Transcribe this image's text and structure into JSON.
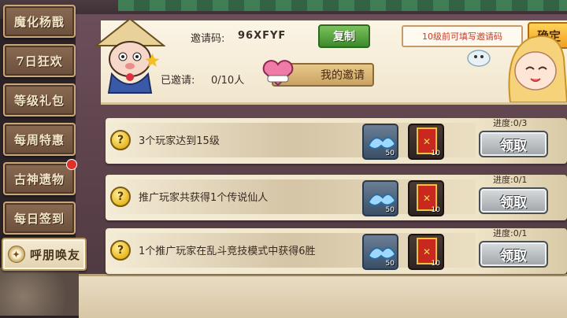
{
  "sidebar": {
    "items": [
      {
        "label": "魔化杨戬"
      },
      {
        "label": "7日狂欢"
      },
      {
        "label": "等级礼包"
      },
      {
        "label": "每周特惠"
      },
      {
        "label": "古神遗物"
      },
      {
        "label": "每日签到"
      },
      {
        "label": "呼朋唤友"
      }
    ]
  },
  "header": {
    "invite_code_label": "邀请码:",
    "invite_code": "96XFYF",
    "copy_label": "复制",
    "input_placeholder": "10级前可填写邀请码",
    "confirm_label": "确定",
    "invited_label": "已邀请:",
    "invited_count": "0/10人",
    "my_invite_label": "我的邀请"
  },
  "tasks": [
    {
      "text": "3个玩家达到15级",
      "progress": "进度:0/3",
      "rewards": [
        {
          "type": "crystal-icon",
          "count": "50"
        },
        {
          "type": "scroll-icon",
          "count": "10"
        }
      ],
      "button": "领取"
    },
    {
      "text": "推广玩家共获得1个传说仙人",
      "progress": "进度:0/1",
      "rewards": [
        {
          "type": "crystal-icon",
          "count": "50"
        },
        {
          "type": "scroll-icon",
          "count": "10"
        }
      ],
      "button": "领取"
    },
    {
      "text": "1个推广玩家在乱斗竞技模式中获得6胜",
      "progress": "进度:0/1",
      "rewards": [
        {
          "type": "crystal-icon",
          "count": "50"
        },
        {
          "type": "scroll-icon",
          "count": "10"
        }
      ],
      "button": "领取"
    }
  ],
  "colors": {
    "accent_green": "#3e8a2c",
    "confirm_yellow": "#f0a020",
    "notice_red": "#e0302a"
  }
}
